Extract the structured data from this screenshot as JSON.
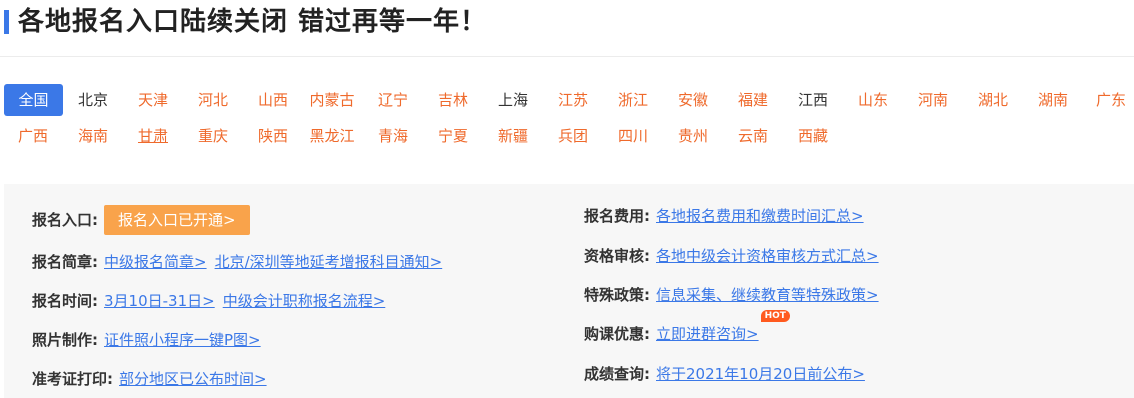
{
  "header": {
    "title": "各地报名入口陆续关闭 错过再等一年！"
  },
  "regions": {
    "row1": [
      "全国",
      "北京",
      "天津",
      "河北",
      "山西",
      "内蒙古",
      "辽宁",
      "吉林",
      "上海",
      "江苏",
      "浙江",
      "安徽",
      "福建",
      "江西",
      "山东",
      "河南",
      "湖北",
      "湖南",
      "广东"
    ],
    "row2": [
      "广西",
      "海南",
      "甘肃",
      "重庆",
      "陕西",
      "黑龙江",
      "青海",
      "宁夏",
      "新疆",
      "兵团",
      "四川",
      "贵州",
      "云南",
      "西藏"
    ]
  },
  "info": {
    "left": [
      {
        "label": "报名入口:",
        "button": "报名入口已开通>"
      },
      {
        "label": "报名简章:",
        "links": [
          "中级报名简章>",
          "北京/深圳等地延考增报科目通知>"
        ]
      },
      {
        "label": "报名时间:",
        "links": [
          "3月10日-31日>",
          "中级会计职称报名流程>"
        ]
      },
      {
        "label": "照片制作:",
        "links": [
          "证件照小程序一键P图>"
        ]
      },
      {
        "label": "准考证打印:",
        "links": [
          "部分地区已公布时间>"
        ]
      }
    ],
    "right": [
      {
        "label": "报名费用:",
        "links": [
          "各地报名费用和缴费时间汇总>"
        ]
      },
      {
        "label": "资格审核:",
        "links": [
          "各地中级会计资格审核方式汇总>"
        ]
      },
      {
        "label": "特殊政策:",
        "links": [
          "信息采集、继续教育等特殊政策>"
        ]
      },
      {
        "label": "购课优惠:",
        "links": [
          "立即进群咨询>"
        ],
        "badge": "HOT"
      },
      {
        "label": "成绩查询:",
        "links": [
          "将于2021年10月20日前公布>"
        ]
      }
    ]
  }
}
